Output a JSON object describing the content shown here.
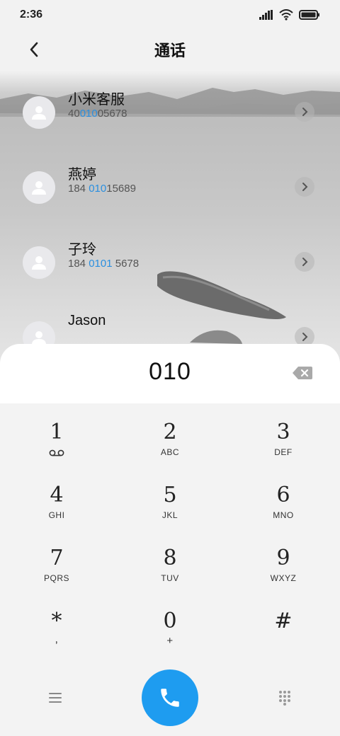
{
  "status_bar": {
    "time": "2:36",
    "icons": [
      "signal-icon",
      "wifi-icon",
      "battery-icon"
    ]
  },
  "header": {
    "title": "通话",
    "back_icon": "back-chevron-icon"
  },
  "contacts": [
    {
      "name": "小米客服",
      "number_parts": [
        "40",
        "010",
        "05678"
      ]
    },
    {
      "name": "燕婷",
      "number_parts": [
        "184 ",
        "010",
        "15689"
      ]
    },
    {
      "name": "子玲",
      "number_parts": [
        "184 ",
        "0101",
        " 5678"
      ]
    },
    {
      "name": "Jason",
      "number_parts": [
        "",
        "",
        ""
      ]
    }
  ],
  "dialer": {
    "typed_number": "010",
    "delete_icon": "backspace-icon",
    "keys": [
      {
        "digit": "1",
        "sub": "voicemail-icon"
      },
      {
        "digit": "2",
        "sub": "ABC"
      },
      {
        "digit": "3",
        "sub": "DEF"
      },
      {
        "digit": "4",
        "sub": "GHI"
      },
      {
        "digit": "5",
        "sub": "JKL"
      },
      {
        "digit": "6",
        "sub": "MNO"
      },
      {
        "digit": "7",
        "sub": "PQRS"
      },
      {
        "digit": "8",
        "sub": "TUV"
      },
      {
        "digit": "9",
        "sub": "WXYZ"
      },
      {
        "digit": "*",
        "sub": ","
      },
      {
        "digit": "0",
        "sub": "+"
      },
      {
        "digit": "#",
        "sub": ""
      }
    ]
  },
  "bottom_bar": {
    "menu_icon": "menu-icon",
    "call_icon": "phone-icon",
    "keypad_icon": "keypad-icon"
  },
  "colors": {
    "accent": "#2a8fe0",
    "call_button": "#1e9cf0"
  }
}
